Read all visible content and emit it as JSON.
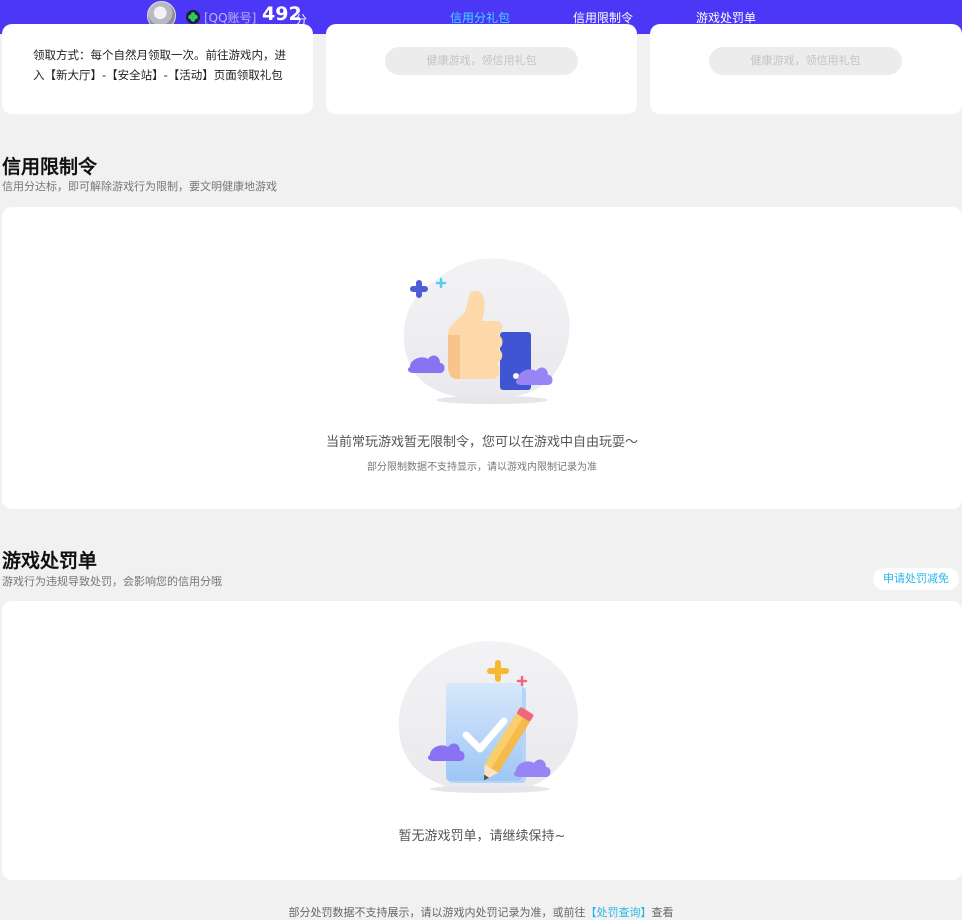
{
  "header": {
    "account_tag": "[QQ账号]",
    "score": "492",
    "score_unit": "分",
    "nav": [
      {
        "label": "信用分礼包",
        "active": true
      },
      {
        "label": "信用限制令",
        "active": false
      },
      {
        "label": "游戏处罚单",
        "active": false
      }
    ]
  },
  "gift": {
    "claim_text": "领取方式：每个自然月领取一次。前往游戏内，进入【新大厅】-【安全站】-【活动】页面领取礼包",
    "disabled_button_label": "健康游戏，领信用礼包"
  },
  "restriction": {
    "title": "信用限制令",
    "subtitle": "信用分达标，即可解除游戏行为限制，要文明健康地游戏",
    "empty_main": "当前常玩游戏暂无限制令，您可以在游戏中自由玩耍～",
    "empty_sub": "部分限制数据不支持显示，请以游戏内限制记录为准"
  },
  "penalty": {
    "title": "游戏处罚单",
    "subtitle": "游戏行为违规导致处罚，会影响您的信用分哦",
    "appeal_button": "申请处罚减免",
    "empty_main": "暂无游戏罚单，请继续保持~"
  },
  "footer": {
    "text_before": "部分处罚数据不支持展示，请以游戏内处罚记录为准，或前往",
    "link": "【处罚查询】",
    "text_after": "查看"
  },
  "colors": {
    "topbar": "#4d37f6",
    "nav_active": "#3fdcff",
    "link": "#28b6ea",
    "page_bg": "#f1f1f2"
  },
  "icons": [
    "avatar",
    "clover-icon",
    "thumbs-up-illustration",
    "clipboard-pencil-illustration"
  ]
}
